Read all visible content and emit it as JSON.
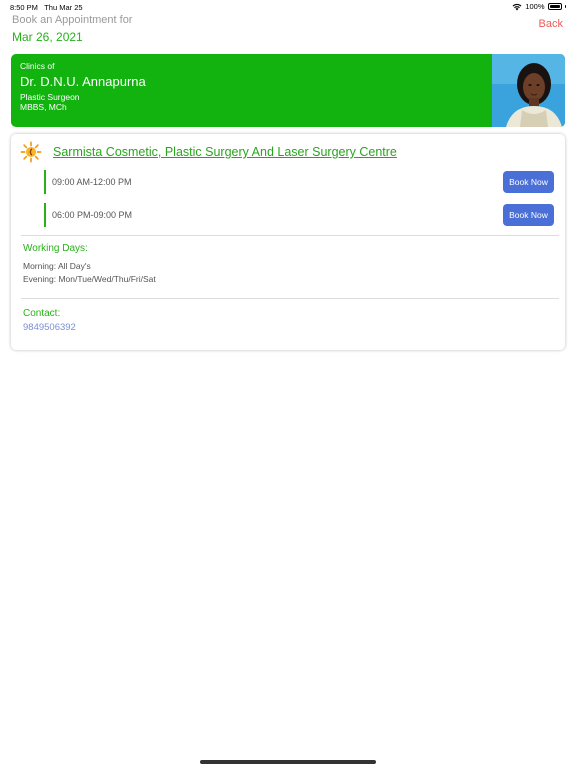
{
  "status_bar": {
    "time": "8:50 PM",
    "date": "Thu Mar 25",
    "battery": "100%",
    "icons": [
      "wifi-icon",
      "battery-icon"
    ]
  },
  "header": {
    "label": "Book an Appointment for",
    "date": "Mar 26, 2021",
    "back_label": "Back"
  },
  "doctor": {
    "caption": "Clinics of",
    "name": "Dr. D.N.U. Annapurna",
    "specialty": "Plastic Surgeon",
    "degree": "MBBS, MCh"
  },
  "clinic": {
    "logo_icon": "sun-logo-icon",
    "name": "Sarmista Cosmetic, Plastic Surgery And Laser Surgery Centre",
    "slots": [
      {
        "time": "09:00 AM-12:00 PM",
        "button": "Book Now"
      },
      {
        "time": "06:00 PM-09:00 PM",
        "button": "Book Now"
      }
    ],
    "working_days": {
      "label": "Working Days:",
      "morning": "Morning: All Day's",
      "evening": "Evening: Mon/Tue/Wed/Thu/Fri/Sat"
    },
    "contact": {
      "label": "Contact:",
      "phone": "9849506392"
    }
  },
  "colors": {
    "accent_green": "#12b30e",
    "text_green": "#28b21a",
    "button_blue": "#4a6fd6",
    "back_red": "#ef5a5a",
    "phone_blue": "#7b8fd1"
  }
}
